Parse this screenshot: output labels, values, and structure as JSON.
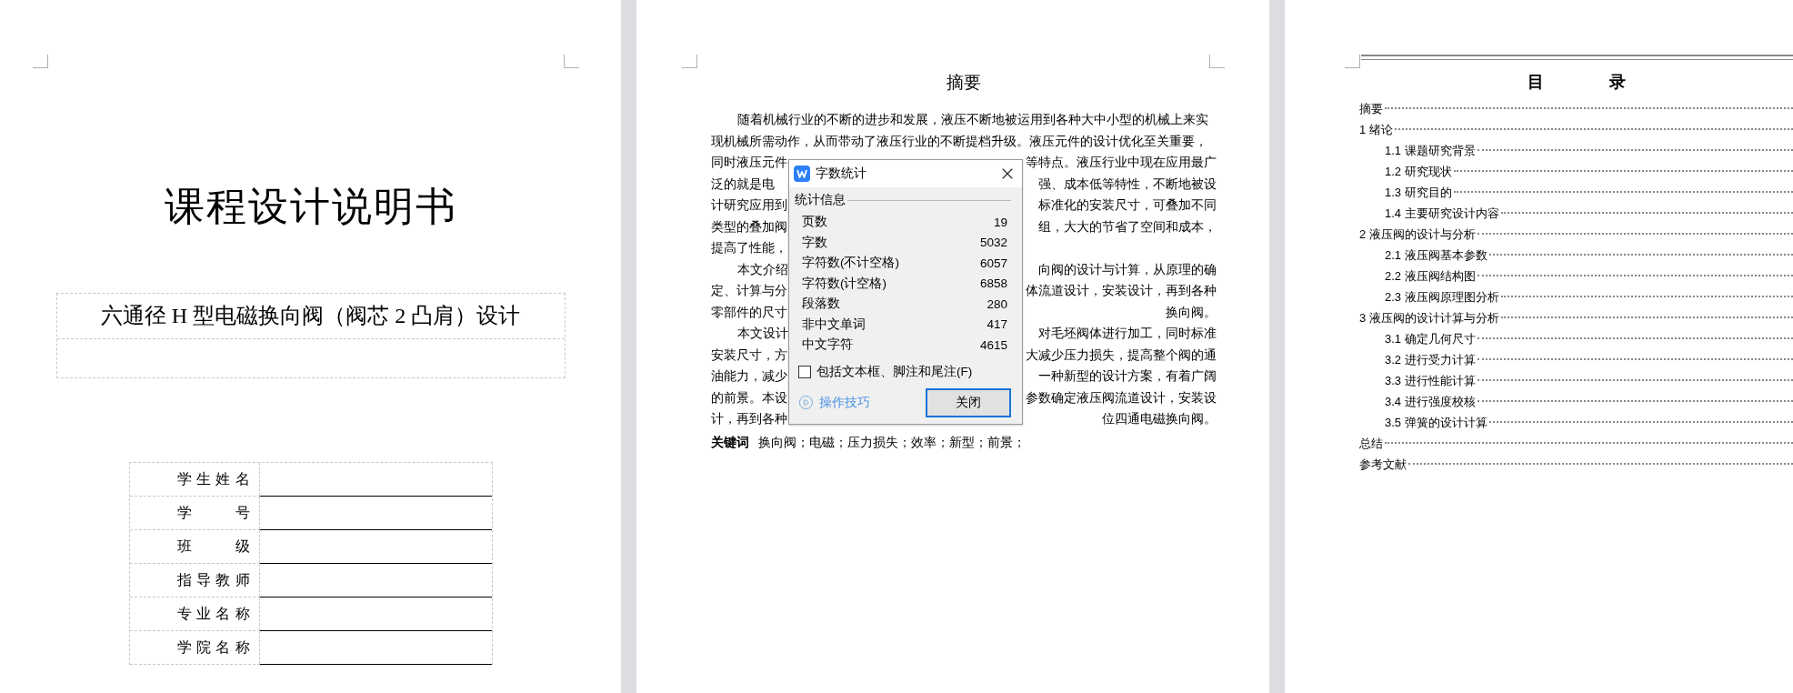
{
  "cover_page": {
    "title": "课程设计说明书",
    "subject": "六通径 H 型电磁换向阀（阀芯 2 凸肩）设计",
    "info_rows": [
      {
        "label": "学生姓名"
      },
      {
        "label": "学号"
      },
      {
        "label": "班级"
      },
      {
        "label": "指导教师"
      },
      {
        "label": "专业名称"
      },
      {
        "label": "学院名称"
      }
    ]
  },
  "abstract_page": {
    "title": "摘要",
    "lines": [
      {
        "indent": true,
        "left": "随着机械行业的不断的进步和发展，液压不断地被运用到各种大中小型的机械上来实"
      },
      {
        "indent": false,
        "left": "现机械所需动作，从而带动了液压行业的不断提档升级。液压元件的设计优化至关重要，"
      },
      {
        "indent": false,
        "left": "同时液压元件",
        "right": "等特点。液压行业中现在应用最广"
      },
      {
        "indent": false,
        "left": "泛的就是电",
        "right": "强、成本低等特性，不断地被设"
      },
      {
        "indent": false,
        "left": "计研究应用到",
        "right": "标准化的安装尺寸，可叠加不同"
      },
      {
        "indent": false,
        "left": "类型的叠加阀",
        "right": "组，大大的节省了空间和成本，"
      },
      {
        "indent": false,
        "left": "提高了性能，"
      },
      {
        "indent": true,
        "left": "本文介绍",
        "right": "向阀的设计与计算，从原理的确"
      },
      {
        "indent": false,
        "left": "定、计算与分",
        "right": "体流道设计，安装设计，再到各种"
      },
      {
        "indent": false,
        "left": "零部件的尺寸",
        "right": "换向阀。"
      },
      {
        "indent": true,
        "left": "本文设计",
        "right": "对毛坯阀体进行加工，同时标准"
      },
      {
        "indent": false,
        "left": "安装尺寸，方",
        "right": "大减少压力损失，提高整个阀的通"
      },
      {
        "indent": false,
        "left": "油能力，减少",
        "right": "一种新型的设计方案，有着广阔"
      },
      {
        "indent": false,
        "left": "的前景。本设",
        "right": "参数确定液压阀流道设计，安装设"
      },
      {
        "indent": false,
        "left": "计，再到各种",
        "right": "位四通电磁换向阀。"
      }
    ],
    "keywords": {
      "label": "关键词",
      "text": "换向阀；电磁；压力损失；效率；新型；前景；"
    }
  },
  "dialog": {
    "title": "字数统计",
    "group_label": "统计信息",
    "stats": [
      {
        "label": "页数",
        "value": "19"
      },
      {
        "label": "字数",
        "value": "5032"
      },
      {
        "label": "字符数(不计空格)",
        "value": "6057"
      },
      {
        "label": "字符数(计空格)",
        "value": "6858"
      },
      {
        "label": "段落数",
        "value": "280"
      },
      {
        "label": "非中文单词",
        "value": "417"
      },
      {
        "label": "中文字符",
        "value": "4615"
      }
    ],
    "checkbox": {
      "label": "包括文本框、脚注和尾注(F)",
      "checked": false
    },
    "tips_link": "操作技巧",
    "close_button": "关闭"
  },
  "toc_page": {
    "title": "目录",
    "entries": [
      {
        "text": "摘要"
      },
      {
        "text": "1 绪论",
        "children": [
          {
            "text": "1.1 课题研究背景"
          },
          {
            "text": "1.2 研究现状"
          },
          {
            "text": "1.3 研究目的"
          },
          {
            "text": "1.4 主要研究设计内容"
          }
        ]
      },
      {
        "text": "2 液压阀的设计与分析",
        "children": [
          {
            "text": "2.1 液压阀基本参数"
          },
          {
            "text": "2.2 液压阀结构图"
          },
          {
            "text": "2.3 液压阀原理图分析"
          }
        ]
      },
      {
        "text": "3 液压阀的设计计算与分析",
        "children": [
          {
            "text": "3.1 确定几何尺寸"
          },
          {
            "text": "3.2 进行受力计算"
          },
          {
            "text": "3.3 进行性能计算"
          },
          {
            "text": "3.4 进行强度校核"
          },
          {
            "text": "3.5 弹簧的设计计算"
          }
        ]
      },
      {
        "text": "总结"
      },
      {
        "text": "参考文献"
      }
    ]
  }
}
